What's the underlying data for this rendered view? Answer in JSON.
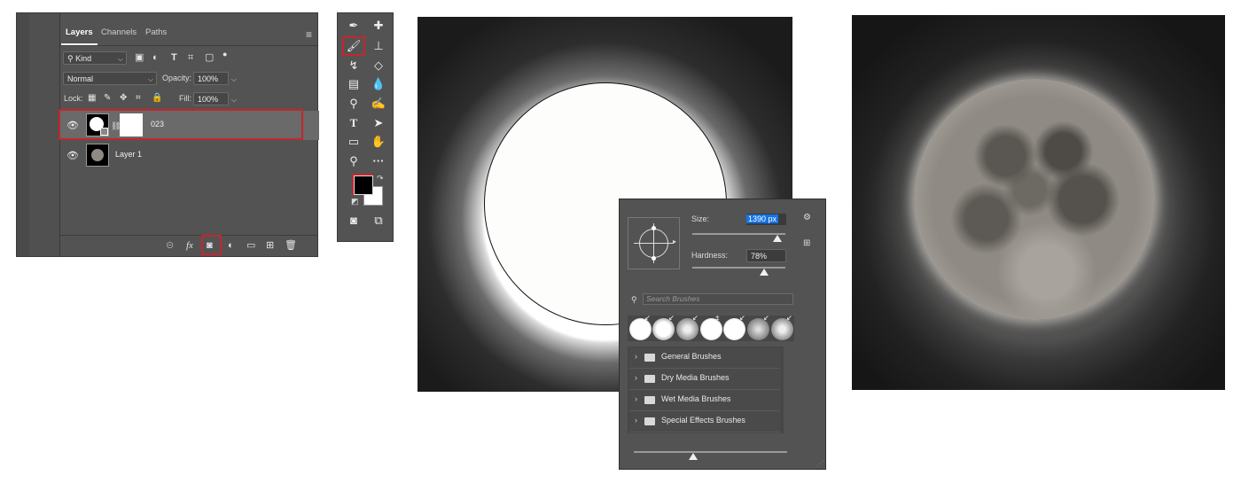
{
  "layers_panel": {
    "tabs": [
      "Layers",
      "Channels",
      "Paths"
    ],
    "filter_kind": "Kind",
    "blend_mode": "Normal",
    "opacity_label": "Opacity:",
    "opacity_value": "100%",
    "lock_label": "Lock:",
    "fill_label": "Fill:",
    "fill_value": "100%",
    "layers": [
      {
        "name": "023"
      },
      {
        "name": "Layer 1"
      }
    ],
    "bottom_icons": [
      "link-icon",
      "fx-icon",
      "mask-icon",
      "adjustment-icon",
      "group-folder-icon",
      "new-layer-icon",
      "trash-icon"
    ],
    "fx_label": "fx"
  },
  "tools_panel": {
    "tools": [
      "eyedropper-icon",
      "healing-brush-icon",
      "brush-icon",
      "clone-stamp-icon",
      "history-brush-icon",
      "eraser-icon",
      "gradient-icon",
      "blur-icon",
      "dodge-icon",
      "pen-icon",
      "type-icon",
      "path-select-icon",
      "rectangle-icon",
      "hand-icon",
      "zoom-icon",
      "more-tools-icon",
      "quick-mask-icon",
      "screen-mode-icon"
    ],
    "foreground_color": "#000000",
    "background_color": "#ffffff"
  },
  "brush_popup": {
    "size_label": "Size:",
    "size_value": "1390 px",
    "hardness_label": "Hardness:",
    "hardness_value": "78%",
    "search_placeholder": "Search Brushes",
    "groups": [
      "General Brushes",
      "Dry Media Brushes",
      "Wet Media Brushes",
      "Special Effects Brushes"
    ]
  },
  "colors": {
    "highlight_red": "#c4262e",
    "panel_bg": "#535353",
    "selection_blue": "#1473e6"
  }
}
